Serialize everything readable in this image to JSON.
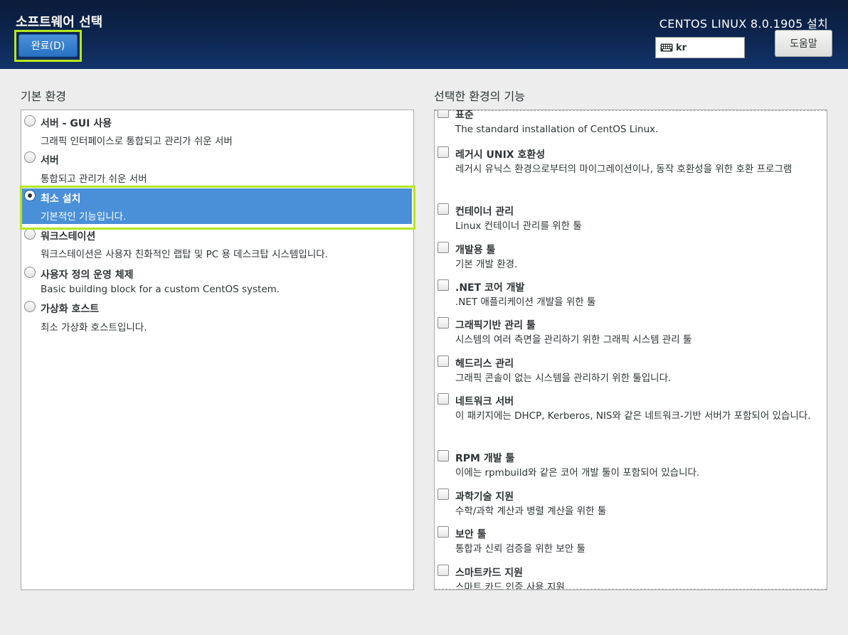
{
  "header": {
    "title": "소프트웨어 선택",
    "done_label": "완료(D)",
    "product": "CENTOS LINUX 8.0.1905 설치",
    "keyboard_layout": "kr",
    "help_label": "도움말"
  },
  "base_env": {
    "label": "기본 환경",
    "items": [
      {
        "name": "서버 - GUI 사용",
        "desc": "그래픽 인터페이스로 통합되고 관리가 쉬운 서버",
        "selected": false
      },
      {
        "name": "서버",
        "desc": "통합되고 관리가 쉬운 서버",
        "selected": false
      },
      {
        "name": "최소 설치",
        "desc": "기본적인 기능입니다.",
        "selected": true
      },
      {
        "name": "워크스테이션",
        "desc": "워크스테이션은 사용자 친화적인 랩탑 및 PC 용 데스크탑 시스템입니다.",
        "selected": false
      },
      {
        "name": "사용자 정의 운영 체제",
        "desc": "Basic building block for a custom CentOS system.",
        "selected": false
      },
      {
        "name": "가상화 호스트",
        "desc": "최소 가상화 호스트입니다.",
        "selected": false
      }
    ]
  },
  "addons": {
    "label": "선택한 환경의 기능",
    "items": [
      {
        "name": "표준",
        "desc": "The standard installation of CentOS Linux.",
        "checked": false
      },
      {
        "name": "레거시 UNIX 호환성",
        "desc": "레거시 유닉스 환경으로부터의 마이그레이션이나, 동작 호환성을 위한 호환 프로그램",
        "checked": false
      },
      {
        "name": "컨테이너 관리",
        "desc": "Linux 컨테이너 관리를 위한 툴",
        "checked": false
      },
      {
        "name": "개발용 툴",
        "desc": "기본 개발 환경.",
        "checked": false
      },
      {
        "name": ".NET 코어 개발",
        "desc": ".NET 애플리케이션 개발을 위한 툴",
        "checked": false
      },
      {
        "name": "그래픽기반 관리 툴",
        "desc": "시스템의 여러 측면을 관리하기 위한 그래픽 시스템 관리 툴",
        "checked": false
      },
      {
        "name": "헤드리스 관리",
        "desc": "그래픽 콘솔이 없는 시스템을 관리하기 위한 툴입니다.",
        "checked": false
      },
      {
        "name": "네트워크 서버",
        "desc": "이 패키지에는 DHCP, Kerberos, NIS와 같은 네트워크-기반 서버가 포함되어 있습니다.",
        "checked": false
      },
      {
        "name": "RPM 개발 툴",
        "desc": "이에는 rpmbuild와 같은 코어 개발 툴이 포함되어 있습니다.",
        "checked": false
      },
      {
        "name": "과학기술 지원",
        "desc": "수학/과학 계산과 병렬 계산을 위한 툴",
        "checked": false
      },
      {
        "name": "보안 툴",
        "desc": "통합과 신뢰 검증을 위한 보안 툴",
        "checked": false
      },
      {
        "name": "스마트카드 지원",
        "desc": "스마트 카드 인증 사용 지원",
        "checked": false
      }
    ]
  }
}
